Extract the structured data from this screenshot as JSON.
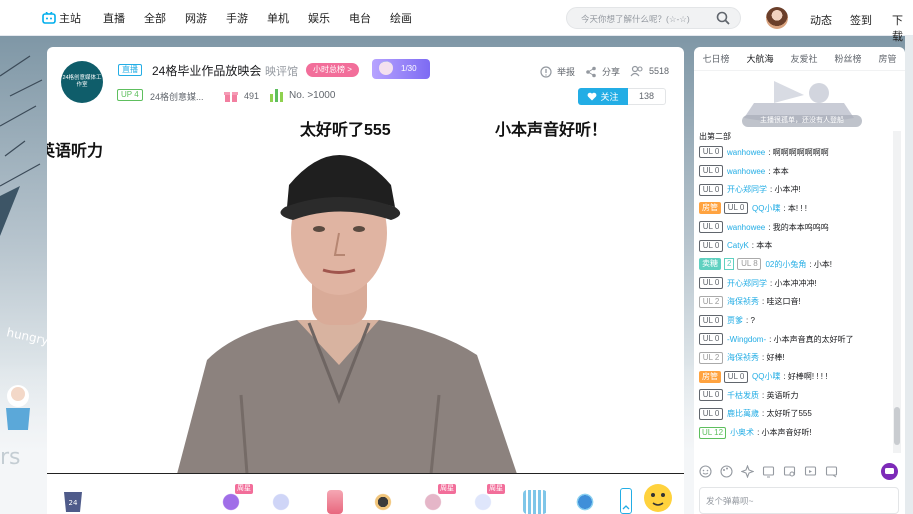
{
  "nav": {
    "items": [
      "主站",
      "直播",
      "全部",
      "网游",
      "手游",
      "单机",
      "娱乐",
      "电台",
      "绘画"
    ],
    "search_placeholder": "今天你想了解什么呢？(☆-☆)",
    "right": [
      "动态",
      "签到",
      "下载"
    ]
  },
  "room": {
    "live_tag": "直播",
    "title": "24格毕业作品放映会",
    "area": "映评馆",
    "rank_badge": "小时总榜 >",
    "ticket": "1/30",
    "up_tag": "UP 4",
    "up_name": "24格创意媒...",
    "gift_count": "491",
    "rank_no": "No. >1000",
    "report": "举报",
    "share": "分享",
    "viewers": "5518",
    "follow": "关注",
    "followers": "138",
    "avatar_text": "24格创意媒体工作室"
  },
  "danmaku": [
    {
      "text": "太好听了555"
    },
    {
      "text": "小本声音好听！"
    },
    {
      "text": "英语听力"
    }
  ],
  "giftbar": {
    "tags": [
      "周星",
      "周星",
      "周星"
    ]
  },
  "side": {
    "tabs": [
      "七日榜",
      "大航海",
      "友爱社",
      "粉丝榜",
      "房管"
    ],
    "active_tab": "大航海",
    "empty_text": "主播很孤单，还没有人登船",
    "input_placeholder": "发个弹幕呗~"
  },
  "chat": {
    "first_line": "出第二部",
    "lines": [
      {
        "ul": "UL 0",
        "name": "wanhowee",
        "msg": "啊啊啊啊啊啊啊"
      },
      {
        "ul": "UL 0",
        "name": "wanhowee",
        "msg": "本本"
      },
      {
        "ul": "UL 0",
        "name": "开心郑同学",
        "msg": "小本冲!"
      },
      {
        "badge": "房管",
        "ul": "UL 0",
        "name": "QQ小喋",
        "msg": "本! ! !"
      },
      {
        "ul": "UL 0",
        "name": "wanhowee",
        "msg": "我的本本呜呜呜"
      },
      {
        "ul": "UL 0",
        "name": "CatyK",
        "msg": "本本"
      },
      {
        "medal": "卖糖",
        "medal_level": "2",
        "ul": "UL 8",
        "name": "02的小兔角",
        "msg": "小本!"
      },
      {
        "ul": "UL 0",
        "name": "开心郑同学",
        "msg": "小本冲冲冲!"
      },
      {
        "ul": "UL 2",
        "name": "海保祯秀",
        "msg": "哇这口音!"
      },
      {
        "ul": "UL 0",
        "name": "贾爹",
        "msg": "?"
      },
      {
        "ul": "UL 0",
        "name": "-Wingdom-",
        "msg": "小本声音真的太好听了"
      },
      {
        "ul": "UL 2",
        "name": "海保祯秀",
        "msg": "好棒!"
      },
      {
        "badge": "房管",
        "ul": "UL 0",
        "name": "QQ小喋",
        "msg": "好棒啊! ! ! !"
      },
      {
        "ul": "UL 0",
        "name": "千枯发质",
        "msg": "英语听力"
      },
      {
        "ul": "UL 0",
        "name": "鹿比萬歲",
        "msg": "太好听了555"
      },
      {
        "ul": "UL 12",
        "name": "小奥术",
        "msg": "小本声音好听!"
      }
    ]
  },
  "colors": {
    "accent": "#23ade5",
    "pink": "#f26e9a",
    "orange": "#ffa340",
    "teal": "#5fd0c0",
    "green": "#5ebf5e"
  }
}
